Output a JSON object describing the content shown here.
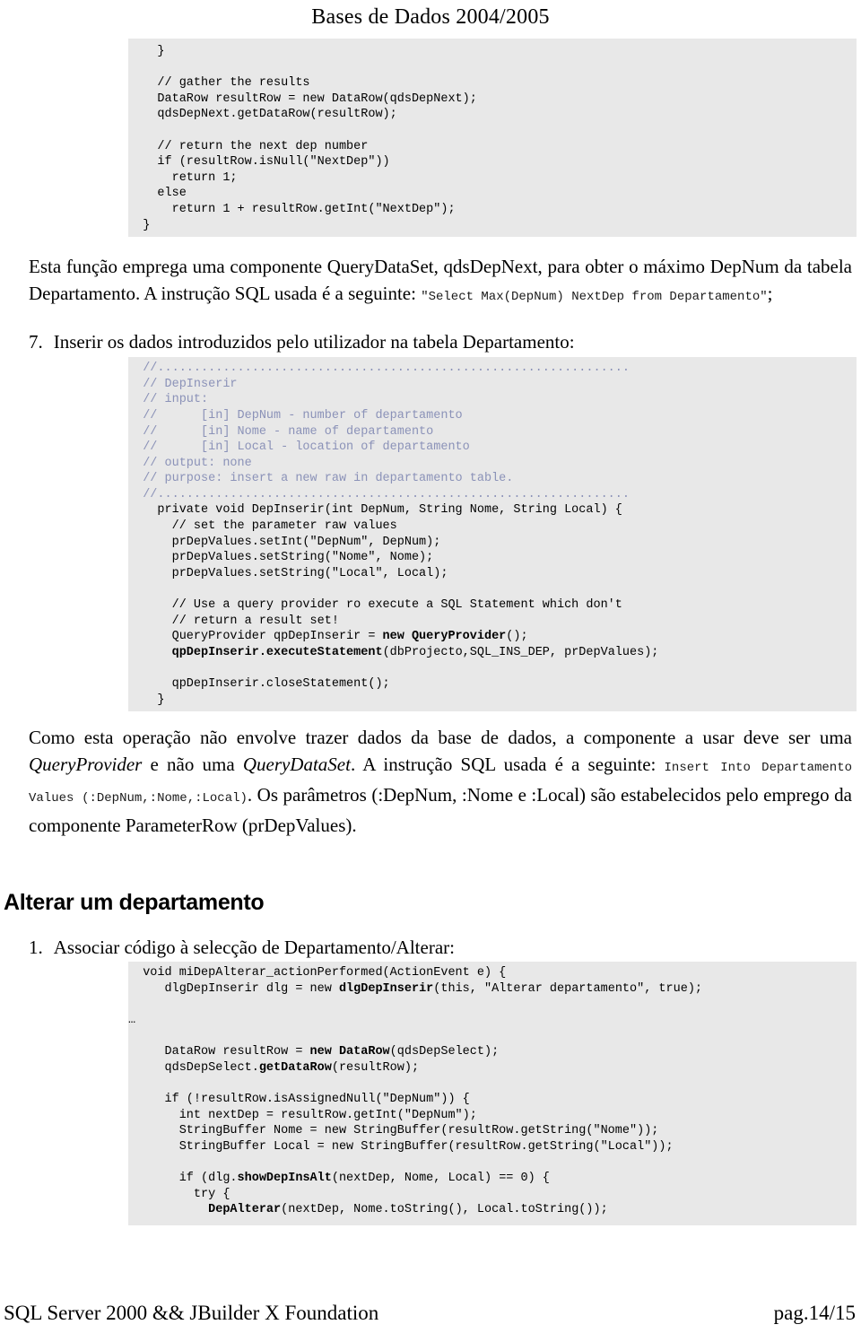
{
  "header": {
    "title": "Bases de Dados 2004/2005"
  },
  "code_block_1": {
    "lines": [
      [
        {
          "t": "    }",
          "s": "plain"
        }
      ],
      [
        {
          "t": "",
          "s": "plain"
        }
      ],
      [
        {
          "t": "    // gather the results",
          "s": "plain"
        }
      ],
      [
        {
          "t": "    DataRow resultRow = new DataRow(qdsDepNext);",
          "s": "plain"
        }
      ],
      [
        {
          "t": "    qdsDepNext.getDataRow(resultRow);",
          "s": "plain"
        }
      ],
      [
        {
          "t": "",
          "s": "plain"
        }
      ],
      [
        {
          "t": "    // return the next dep number",
          "s": "plain"
        }
      ],
      [
        {
          "t": "    if (resultRow.isNull(\"NextDep\"))",
          "s": "plain"
        }
      ],
      [
        {
          "t": "      return 1;",
          "s": "plain"
        }
      ],
      [
        {
          "t": "    else",
          "s": "plain"
        }
      ],
      [
        {
          "t": "      return 1 + resultRow.getInt(\"NextDep\");",
          "s": "plain"
        }
      ],
      [
        {
          "t": "  }",
          "s": "plain"
        }
      ]
    ]
  },
  "paragraph_1": {
    "part_1": "Esta função emprega uma componente QueryDataSet, qdsDepNext, para obter o máximo DepNum da tabela Departamento. A instrução SQL usada é a seguinte: ",
    "sql_1": "\"Select Max(DepNum) NextDep from Departamento\"",
    "part_2": ";"
  },
  "item_7": {
    "number": "7.",
    "text": "Inserir os dados introduzidos pelo utilizador na tabela Departamento:"
  },
  "code_block_2": {
    "lines": [
      [
        {
          "t": "  //.................................................................",
          "s": "cmt"
        }
      ],
      [
        {
          "t": "  // DepInserir",
          "s": "cmt"
        }
      ],
      [
        {
          "t": "  // input:",
          "s": "cmt"
        }
      ],
      [
        {
          "t": "  //      [in] DepNum - number of departamento",
          "s": "cmt"
        }
      ],
      [
        {
          "t": "  //      [in] Nome - name of departamento",
          "s": "cmt"
        }
      ],
      [
        {
          "t": "  //      [in] Local - location of departamento",
          "s": "cmt"
        }
      ],
      [
        {
          "t": "  // output: none",
          "s": "cmt"
        }
      ],
      [
        {
          "t": "  // purpose: insert a new raw in departamento table.",
          "s": "cmt"
        }
      ],
      [
        {
          "t": "  //.................................................................",
          "s": "cmt"
        }
      ],
      [
        {
          "t": "    private void DepInserir(int DepNum, String Nome, String Local) {",
          "s": "plain"
        }
      ],
      [
        {
          "t": "      // set the parameter raw values",
          "s": "plain"
        }
      ],
      [
        {
          "t": "      prDepValues.setInt(\"DepNum\", DepNum);",
          "s": "plain"
        }
      ],
      [
        {
          "t": "      prDepValues.setString(\"Nome\", Nome);",
          "s": "plain"
        }
      ],
      [
        {
          "t": "      prDepValues.setString(\"Local\", Local);",
          "s": "plain"
        }
      ],
      [
        {
          "t": "",
          "s": "plain"
        }
      ],
      [
        {
          "t": "      // Use a query provider ro execute a SQL Statement which don't",
          "s": "plain"
        }
      ],
      [
        {
          "t": "      // return a result set!",
          "s": "plain"
        }
      ],
      [
        {
          "t": "      QueryProvider qpDepInserir = ",
          "s": "plain"
        },
        {
          "t": "new QueryProvider",
          "s": "bold"
        },
        {
          "t": "();",
          "s": "plain"
        }
      ],
      [
        {
          "t": "      ",
          "s": "plain"
        },
        {
          "t": "qpDepInserir.executeStatement",
          "s": "bold"
        },
        {
          "t": "(dbProjecto,SQL_INS_DEP, prDepValues);",
          "s": "plain"
        }
      ],
      [
        {
          "t": "",
          "s": "plain"
        }
      ],
      [
        {
          "t": "      qpDepInserir.closeStatement();",
          "s": "plain"
        }
      ],
      [
        {
          "t": "    }",
          "s": "plain"
        }
      ]
    ]
  },
  "paragraph_2": {
    "part_1": "Como esta operação não envolve trazer dados da base de dados, a componente a usar deve ser uma ",
    "ital_1": "QueryProvider",
    "part_2": " e não uma ",
    "ital_2": "QueryDataSet",
    "part_3": ". A instrução SQL usada é a seguinte: ",
    "sql_1": "Insert Into Departamento Values (:DepNum,:Nome,:Local)",
    "part_4": ". Os parâmetros (:DepNum, :Nome e :Local) são estabelecidos pelo emprego da componente ParameterRow (prDepValues)."
  },
  "section_heading": "Alterar um departamento",
  "item_1": {
    "number": "1.",
    "text": "Associar código à selecção de Departamento/Alterar:"
  },
  "code_block_3": {
    "lines": [
      [
        {
          "t": "  void miDepAlterar_actionPerformed(ActionEvent e) {",
          "s": "plain"
        }
      ],
      [
        {
          "t": "     dlgDepInserir dlg = new ",
          "s": "plain"
        },
        {
          "t": "dlgDepInserir",
          "s": "bold"
        },
        {
          "t": "(this, \"Alterar departamento\", true);",
          "s": "plain"
        }
      ],
      [
        {
          "t": "",
          "s": "plain"
        }
      ],
      [
        {
          "t": "…",
          "s": "plain"
        }
      ],
      [
        {
          "t": "",
          "s": "plain"
        }
      ],
      [
        {
          "t": "     DataRow resultRow = ",
          "s": "plain"
        },
        {
          "t": "new DataRow",
          "s": "bold"
        },
        {
          "t": "(qdsDepSelect);",
          "s": "plain"
        }
      ],
      [
        {
          "t": "     qdsDepSelect.",
          "s": "plain"
        },
        {
          "t": "getDataRow",
          "s": "bold"
        },
        {
          "t": "(resultRow);",
          "s": "plain"
        }
      ],
      [
        {
          "t": "",
          "s": "plain"
        }
      ],
      [
        {
          "t": "     if (!resultRow.isAssignedNull(\"DepNum\")) {",
          "s": "plain"
        }
      ],
      [
        {
          "t": "       int nextDep = resultRow.getInt(\"DepNum\");",
          "s": "plain"
        }
      ],
      [
        {
          "t": "       StringBuffer Nome = new StringBuffer(resultRow.getString(\"Nome\"));",
          "s": "plain"
        }
      ],
      [
        {
          "t": "       StringBuffer Local = new StringBuffer(resultRow.getString(\"Local\"));",
          "s": "plain"
        }
      ],
      [
        {
          "t": "",
          "s": "plain"
        }
      ],
      [
        {
          "t": "       if (dlg.",
          "s": "plain"
        },
        {
          "t": "showDepInsAlt",
          "s": "bold"
        },
        {
          "t": "(nextDep, Nome, Local) == 0) {",
          "s": "plain"
        }
      ],
      [
        {
          "t": "         try {",
          "s": "plain"
        }
      ],
      [
        {
          "t": "           ",
          "s": "plain"
        },
        {
          "t": "DepAlterar",
          "s": "bold"
        },
        {
          "t": "(nextDep, Nome.toString(), Local.toString());",
          "s": "plain"
        }
      ]
    ]
  },
  "footer": {
    "left": "SQL Server 2000 && JBuilder X Foundation",
    "right": "pag.14/15"
  },
  "colors": {
    "code_background": "#e8e8e8",
    "comment_text": "#8b92b8",
    "body_text": "#000000",
    "page_background": "#ffffff"
  }
}
